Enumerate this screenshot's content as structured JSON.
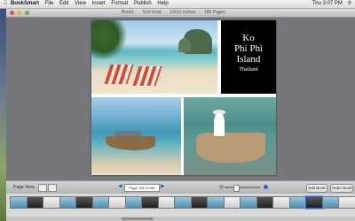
{
  "menubar": {
    "app": "BookSmart",
    "items": [
      "File",
      "Edit",
      "View",
      "Insert",
      "Format",
      "Publish",
      "Help"
    ],
    "status_time": "Thu 3:07 PM"
  },
  "window": {
    "title_parts": [
      "Book1",
      "Sort book",
      "13x11 inches",
      "186 Pages"
    ]
  },
  "page": {
    "title_lines": [
      "Ko",
      "Phi Phi",
      "Island"
    ],
    "subtitle": "Thailand"
  },
  "toolbar": {
    "page_view_label": "Page View",
    "page_field": "Page 118 of 186",
    "edit_book": "Edit Book",
    "order_book": "Order Book"
  },
  "thumbnails": {
    "count": 21,
    "selected_index": 18
  },
  "colors": {
    "accent": "#2f64c7",
    "canvas": "#75777b",
    "title_block_bg": "#000000"
  }
}
